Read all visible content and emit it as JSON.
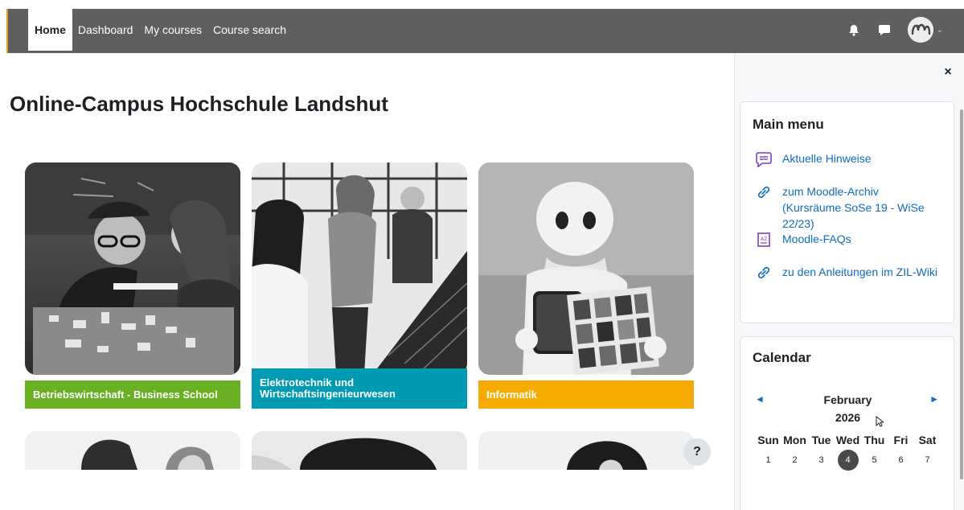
{
  "nav": {
    "links": [
      "Home",
      "Dashboard",
      "My courses",
      "Course search"
    ],
    "active": "Home",
    "icons": [
      "bell-icon",
      "chat-icon",
      "user-avatar",
      "chevron-down-icon"
    ]
  },
  "page_title": "Online-Campus Hochschule Landshut",
  "tiles": [
    {
      "label": "Betriebswirtschaft - Business School",
      "color": "#6ab023"
    },
    {
      "label": "Elektrotechnik und Wirtschaftsingenieurwesen",
      "color": "#009ab3"
    },
    {
      "label": "Informatik",
      "color": "#f6ab00"
    }
  ],
  "help_label": "?",
  "drawer": {
    "close_label": "×",
    "main_menu": {
      "title": "Main menu",
      "items": [
        {
          "icon": "announcement-icon",
          "label": "Aktuelle Hinweise"
        },
        {
          "icon": "link-icon",
          "label": "zum Moodle-Archiv (Kursräume SoSe 19 - WiSe 22/23)"
        },
        {
          "icon": "glossary-icon",
          "label": "Moodle-FAQs"
        },
        {
          "icon": "link-icon",
          "label": "zu den Anleitungen im ZIL-Wiki"
        }
      ]
    },
    "calendar": {
      "title": "Calendar",
      "month": "February",
      "year": "2026",
      "prev": "◄",
      "next": "►",
      "weekdays": [
        "Sun",
        "Mon",
        "Tue",
        "Wed",
        "Thu",
        "Fri",
        "Sat"
      ],
      "first_week": [
        "1",
        "2",
        "3",
        "4",
        "5",
        "6",
        "7"
      ],
      "today": "4"
    }
  }
}
